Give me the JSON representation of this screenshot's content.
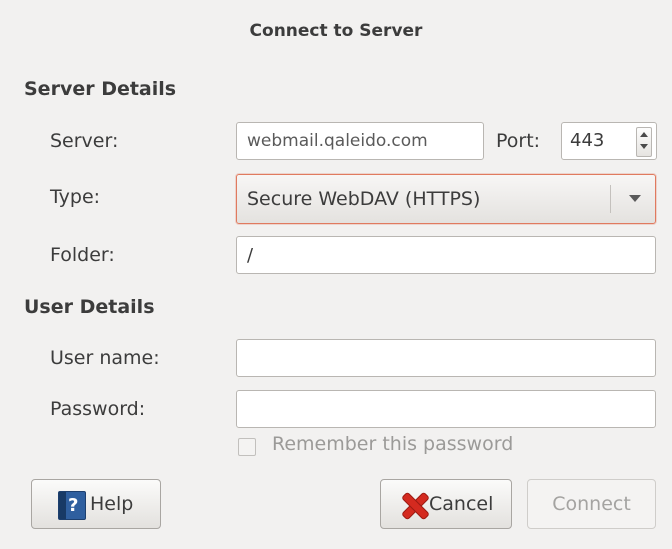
{
  "window": {
    "title": "Connect to Server"
  },
  "server_details": {
    "heading": "Server Details",
    "server_label": "Server:",
    "server_value": "webmail.qaleido.com",
    "port_label": "Port:",
    "port_value": "443",
    "type_label": "Type:",
    "type_value": "Secure WebDAV (HTTPS)",
    "folder_label": "Folder:",
    "folder_value": "/"
  },
  "user_details": {
    "heading": "User Details",
    "username_label": "User name:",
    "username_value": "",
    "password_label": "Password:",
    "password_value": "",
    "remember_label": "Remember this password",
    "remember_checked": false
  },
  "buttons": {
    "help": "Help",
    "cancel": "Cancel",
    "connect": "Connect"
  },
  "icons": {
    "help": "help-book-icon",
    "cancel": "cancel-x-icon",
    "combo_arrow": "chevron-down-icon",
    "spin": "spin-arrows-icon"
  },
  "colors": {
    "focus_border": "#e07a5f",
    "window_bg": "#f2f1f0",
    "disabled_text": "#a4a3a1"
  }
}
